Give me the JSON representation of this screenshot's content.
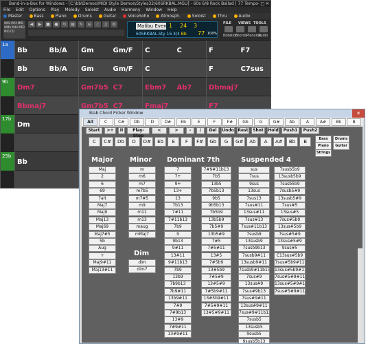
{
  "bib": {
    "title": "Band-in-a-Box for Windows - [C:\\bb\\Demos\\MIDI Style Demos\\Styles32\\60SRKBAL.MGU] - 60s 6/8 Rock Ballad | 77 Tempo",
    "window_controls": "–  □  ✕",
    "menu": [
      "File",
      "Edit",
      "Options",
      "Play",
      "Melody",
      "Soloist",
      "Audio",
      "Harmony",
      "Window",
      "Help"
    ],
    "tracks": [
      {
        "label": "Master",
        "color": "#2d6bc4"
      },
      {
        "label": "Bass",
        "color": "#ffb000"
      },
      {
        "label": "Piano",
        "color": "#ffb000"
      },
      {
        "label": "Drums",
        "color": "#ffb000"
      },
      {
        "label": "Guitar",
        "color": "#ffb000"
      },
      {
        "label": "VoiceSoho",
        "color": "#e03030"
      },
      {
        "label": "Atmosph.",
        "color": "#ffb000"
      },
      {
        "label": "Soloist",
        "color": "#ffb000"
      },
      {
        "label": "Thru",
        "color": "#ffb000"
      },
      {
        "label": "Audio",
        "color": "#ffb000"
      }
    ],
    "control_box": "WAV MP4 MID WMA M4A MP3 MID CD",
    "song_name": "Malibu Evening",
    "bar_pos": "1",
    "beat": "24",
    "third": "3",
    "style": "60SRKBAL.Sty",
    "time_sig": "16 4/4",
    "key": "Bb",
    "tempo": "77",
    "zoom": "100%",
    "views_tabs": [
      "FILE",
      "VIEWS",
      "TOOLS"
    ],
    "views_buttons": [
      "Notation",
      "Chords",
      "Pianoroll",
      "Audio"
    ]
  },
  "grid": {
    "rows": [
      {
        "bar": "1a",
        "barcolor": "blue",
        "chords": [
          {
            "t": "Bb",
            "red": false
          },
          {
            "t": "Bb/A",
            "red": false
          },
          {
            "t": "Gm",
            "red": false
          },
          {
            "t": "Gm/F",
            "red": false
          },
          {
            "t": "C",
            "red": false
          },
          {
            "t": "C",
            "red": false
          },
          {
            "t": "F",
            "red": false
          },
          {
            "t": "F7",
            "red": false
          }
        ]
      },
      {
        "bar": "",
        "barcolor": "",
        "chords": [
          {
            "t": "Bb",
            "red": false
          },
          {
            "t": "Bb/A",
            "red": false
          },
          {
            "t": "Gm",
            "red": false
          },
          {
            "t": "Gm/F",
            "red": false
          },
          {
            "t": "C",
            "red": false
          },
          {
            "t": "",
            "red": false
          },
          {
            "t": "F",
            "red": false
          },
          {
            "t": "C7sus",
            "red": false
          }
        ]
      },
      {
        "bar": "9b",
        "barcolor": "green",
        "chords": [
          {
            "t": "Dm7",
            "red": true
          },
          {
            "t": "",
            "red": false
          },
          {
            "t": "Gm7b5",
            "red": true
          },
          {
            "t": "C7",
            "red": true
          },
          {
            "t": "Ebm7",
            "red": true
          },
          {
            "t": "Ab7",
            "red": true
          },
          {
            "t": "Dbmaj7",
            "red": true
          },
          {
            "t": "",
            "red": false
          }
        ]
      },
      {
        "bar": "",
        "barcolor": "",
        "chords": [
          {
            "t": "Bbmaj7",
            "red": true
          },
          {
            "t": "",
            "red": false
          },
          {
            "t": "Gm7b5",
            "red": true
          },
          {
            "t": "C7",
            "red": true
          },
          {
            "t": "Fmaj7",
            "red": true
          },
          {
            "t": "",
            "red": false
          },
          {
            "t": "F7",
            "red": true
          },
          {
            "t": "",
            "red": false
          }
        ]
      },
      {
        "bar": "17b",
        "barcolor": "green",
        "chords": [
          {
            "t": "Dm",
            "red": false
          },
          {
            "t": "",
            "red": false
          },
          {
            "t": "",
            "red": false
          },
          {
            "t": "",
            "red": false
          },
          {
            "t": "",
            "red": false
          },
          {
            "t": "",
            "red": false
          },
          {
            "t": "",
            "red": false
          },
          {
            "t": "",
            "red": false
          }
        ]
      },
      {
        "bar": "",
        "barcolor": "",
        "chords": [
          {
            "t": "",
            "red": false
          },
          {
            "t": "",
            "red": false
          },
          {
            "t": "",
            "red": false
          },
          {
            "t": "",
            "red": false
          },
          {
            "t": "",
            "red": false
          },
          {
            "t": "",
            "red": false
          },
          {
            "t": "",
            "red": false
          },
          {
            "t": "",
            "red": false
          }
        ]
      },
      {
        "bar": "25b",
        "barcolor": "green",
        "chords": [
          {
            "t": "Bb",
            "red": false
          },
          {
            "t": "",
            "red": false
          },
          {
            "t": "",
            "red": false
          },
          {
            "t": "",
            "red": false
          },
          {
            "t": "",
            "red": false
          },
          {
            "t": "",
            "red": false
          },
          {
            "t": "",
            "red": false
          },
          {
            "t": "",
            "red": false
          }
        ]
      },
      {
        "bar": "",
        "barcolor": "",
        "chords": [
          {
            "t": "",
            "red": false
          },
          {
            "t": "",
            "red": false
          },
          {
            "t": "",
            "red": false
          },
          {
            "t": "",
            "red": false
          },
          {
            "t": "",
            "red": false
          },
          {
            "t": "",
            "red": false
          },
          {
            "t": "",
            "red": false
          },
          {
            "t": "",
            "red": false
          }
        ]
      }
    ]
  },
  "picker": {
    "title": "Biab Chord Picker Window",
    "close": "✕",
    "keys": [
      "All",
      "C",
      "C#",
      "Db",
      "D",
      "D#",
      "Eb",
      "E",
      "F",
      "F#",
      "Gb",
      "G",
      "G#",
      "Ab",
      "A",
      "A#",
      "Bb",
      "B"
    ],
    "actions": [
      "Start",
      ">+",
      "II",
      "Play-Stop",
      "<",
      ">",
      "-",
      "/",
      "Del",
      "Undo",
      "Rest",
      "Shot",
      "Hold",
      "Push1",
      "Push2"
    ],
    "roots": [
      "C",
      "C#",
      "Db",
      "D",
      "D#",
      "Eb",
      "E",
      "F",
      "F#",
      "Gb",
      "G",
      "G#",
      "Ab",
      "A",
      "A#",
      "Bb",
      "B"
    ],
    "group_buttons": [
      "Bass",
      "Piano",
      "Strings",
      "Drums",
      "Guitar"
    ],
    "major_title": "Major",
    "major": [
      "Maj",
      "2",
      "6",
      "69",
      "7alt",
      "Maj7",
      "Maj9",
      "Maj13",
      "Maj69",
      "Maj7#5",
      "5b",
      "Aug",
      "+",
      "Maj9#11",
      "Maj13#11"
    ],
    "minor_title": "Minor",
    "minor": [
      "m",
      "m6",
      "m7",
      "m7b5",
      "m7#5",
      "m9",
      "m11",
      "m13",
      "maug",
      "mMaj7"
    ],
    "dim_title": "Dim",
    "dim": [
      "dim",
      "dim7"
    ],
    "dom_title": "Dominant 7th",
    "dom1": [
      "7",
      "7+",
      "9+",
      "13+",
      "13",
      "7b13",
      "7#11",
      "7#11b13",
      "7b9",
      "9",
      "9b13",
      "9#11",
      "13#11",
      "9#11b13",
      "7b9",
      "13b9",
      "7b9b13",
      "7b9#11",
      "13b9#11",
      "7#9",
      "7#9b13",
      "13#9",
      "7#9#11",
      "13#9#11"
    ],
    "dom2": [
      "7#9#11b13",
      "7b5",
      "13b5",
      "7b5b13",
      "9b5",
      "9b5b13",
      "7b5b9",
      "13b5b9",
      "7b5#9",
      "13b5#9",
      "7#5",
      "7#5#11",
      "13#5",
      "7#5b9",
      "13#5b9",
      "7#5#9",
      "13#5#9",
      "7#5b9#11",
      "13#5b9#11",
      "7#5#9#11",
      "13#5#9#11"
    ],
    "sus_title": "Suspended 4",
    "sus1": [
      "sus",
      "7sus",
      "9sus",
      "13sus",
      "7sus13",
      "7sus#11",
      "13sus#11",
      "7sus#13",
      "7sus#11b13",
      "7susb9",
      "13susb9",
      "7susb9b13",
      "7susb9#11",
      "13susb9#11",
      "7susb9#11b13",
      "7sus#9",
      "13sus#9",
      "7sus#9b13",
      "7sus#9#11",
      "13sus#9#11",
      "7sus#9#11b13",
      "7susb5",
      "13susb5",
      "9susb5",
      "9susb5b13"
    ],
    "sus2": [
      "7susb5b9",
      "13susb5b9",
      "7susb5b9",
      "7susb5#9",
      "13susb5#9",
      "7sus#5",
      "13sus#5",
      "7sus#5b9",
      "13sus#5b9",
      "7sus#5#9",
      "13sus#5#9",
      "9sus#5",
      "C13sus#5b9",
      "7sus#5b9#11",
      "13sus#5b9#11",
      "7sus#5#9#11",
      "13sus#5#9#11",
      "7sus#5#9#11"
    ]
  }
}
